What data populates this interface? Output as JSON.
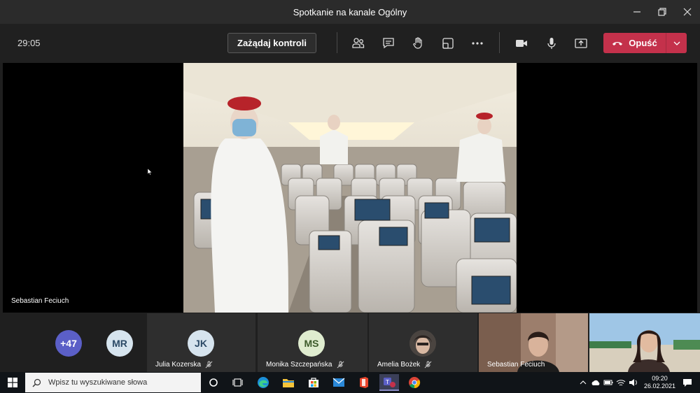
{
  "window": {
    "title": "Spotkanie na kanale Ogólny",
    "controls": [
      "minimize-icon",
      "restore-icon",
      "close-icon"
    ]
  },
  "toolbar": {
    "timer": "29:05",
    "request_control_label": "Zażądaj kontroli",
    "leave_label": "Opuść",
    "icons": [
      "participants-icon",
      "chat-icon",
      "raise-hand-icon",
      "breakout-rooms-icon",
      "more-icon",
      "camera-icon",
      "microphone-icon",
      "share-screen-icon"
    ],
    "leave_color": "#c4314b"
  },
  "stage": {
    "presenter_name": "Sebastian Feciuch"
  },
  "participants": [
    {
      "kind": "overflow",
      "initials": "+47",
      "color": "#5b5fc7"
    },
    {
      "kind": "avatar",
      "initials": "MR",
      "color": "#d6e4ee",
      "name": ""
    },
    {
      "kind": "tile",
      "initials": "JK",
      "color": "#d6e4ee",
      "name": "Julia Kozerska",
      "muted": true
    },
    {
      "kind": "tile",
      "initials": "MS",
      "color": "#dfeccf",
      "name": "Monika Szczepańska",
      "muted": true
    },
    {
      "kind": "tile",
      "initials": "",
      "name": "Amelia Bożek",
      "muted": true
    },
    {
      "kind": "video",
      "name": "Sebastian Feciuch"
    },
    {
      "kind": "video",
      "name": ""
    }
  ],
  "taskbar": {
    "search_placeholder": "Wpisz tu wyszukiwane słowa",
    "apps": [
      "task-view-icon",
      "edge-icon",
      "file-explorer-icon",
      "store-icon",
      "mail-icon",
      "office-icon",
      "teams-icon",
      "chrome-icon"
    ],
    "teams_badge": "1",
    "time": "09:20",
    "date": "26.02.2021"
  }
}
